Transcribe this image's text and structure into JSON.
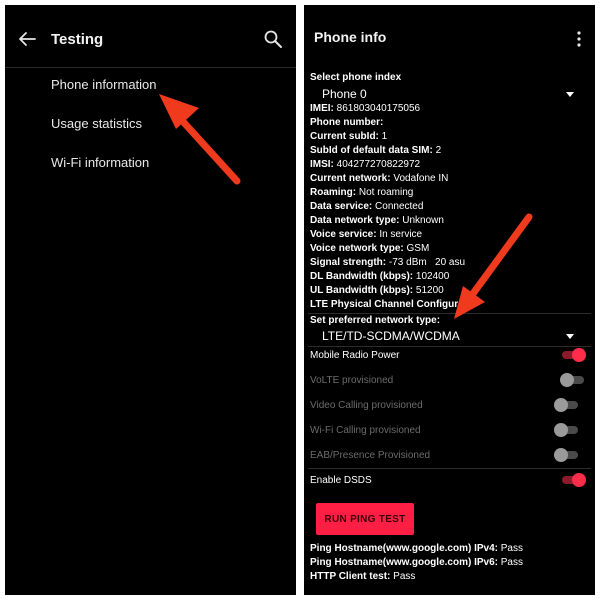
{
  "left": {
    "title": "Testing",
    "menu": [
      "Phone information",
      "Usage statistics",
      "Wi-Fi information"
    ]
  },
  "right": {
    "title": "Phone info",
    "phone_index_label": "Select phone index",
    "phone_index_value": "Phone 0",
    "info": [
      {
        "label": "IMEI:",
        "value": "861803040175056"
      },
      {
        "label": "Phone number:",
        "value": ""
      },
      {
        "label": "Current subId:",
        "value": "1"
      },
      {
        "label": "SubId of default data SIM:",
        "value": "2"
      },
      {
        "label": "IMSI:",
        "value": "404277270822972"
      },
      {
        "label": "Current network:",
        "value": "Vodafone IN"
      },
      {
        "label": "Roaming:",
        "value": "Not roaming"
      },
      {
        "label": "Data service:",
        "value": "Connected"
      },
      {
        "label": "Data network type:",
        "value": "Unknown"
      },
      {
        "label": "Voice service:",
        "value": "In service"
      },
      {
        "label": "Voice network type:",
        "value": "GSM"
      },
      {
        "label": "Signal strength:",
        "value": "-73 dBm   20 asu"
      },
      {
        "label": "DL Bandwidth (kbps):",
        "value": "102400"
      },
      {
        "label": "UL Bandwidth (kbps):",
        "value": "51200"
      },
      {
        "label": "LTE Physical Channel Configurat",
        "value": ""
      }
    ],
    "network_type_label": "Set preferred network type:",
    "network_type_value": "LTE/TD-SCDMA/WCDMA",
    "toggles": [
      {
        "label": "Mobile Radio Power",
        "on": true
      },
      {
        "label": "VoLTE provisioned",
        "on": false
      },
      {
        "label": "Video Calling provisioned",
        "on": false
      },
      {
        "label": "Wi-Fi Calling provisioned",
        "on": false
      },
      {
        "label": "EAB/Presence Provisioned",
        "on": false
      },
      {
        "label": "Enable DSDS",
        "on": true
      }
    ],
    "ping_button": "RUN PING TEST",
    "results": [
      {
        "label": "Ping Hostname(www.google.com) IPv4:",
        "value": "Pass"
      },
      {
        "label": "Ping Hostname(www.google.com) IPv6:",
        "value": "Pass"
      },
      {
        "label": "HTTP Client test:",
        "value": "Pass"
      }
    ]
  },
  "colors": {
    "accent": "#ff1f44",
    "annotation_arrow": "#f03a1e",
    "background": "#000000"
  }
}
